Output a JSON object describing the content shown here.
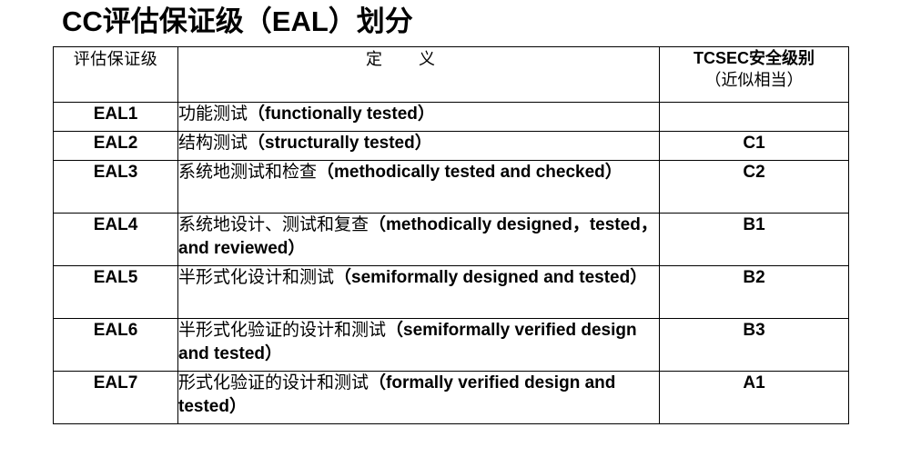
{
  "title": "CC评估保证级（EAL）划分",
  "header": {
    "level": "评估保证级",
    "definition": "定义",
    "tcsec_main": "TCSEC安全级别",
    "tcsec_sub": "（近似相当）"
  },
  "rows": [
    {
      "level": "EAL1",
      "zh": "功能测试",
      "en": "（functionally tested）",
      "tcsec": ""
    },
    {
      "level": "EAL2",
      "zh": "结构测试",
      "en": "（structurally tested）",
      "tcsec": "C1"
    },
    {
      "level": "EAL3",
      "zh": "系统地测试和检查",
      "en": "（methodically tested and checked）",
      "tcsec": "C2"
    },
    {
      "level": "EAL4",
      "zh": "系统地设计、测试和复查",
      "en": "（methodically designed，tested， and reviewed）",
      "tcsec": "B1"
    },
    {
      "level": "EAL5",
      "zh": "半形式化设计和测试",
      "en": "（semiformally designed and tested）",
      "tcsec": "B2"
    },
    {
      "level": "EAL6",
      "zh": "半形式化验证的设计和测试",
      "en": "（semiformally verified design and tested）",
      "tcsec": "B3"
    },
    {
      "level": "EAL7",
      "zh": "形式化验证的设计和测试",
      "en": "（formally verified design and tested）",
      "tcsec": "A1"
    }
  ]
}
